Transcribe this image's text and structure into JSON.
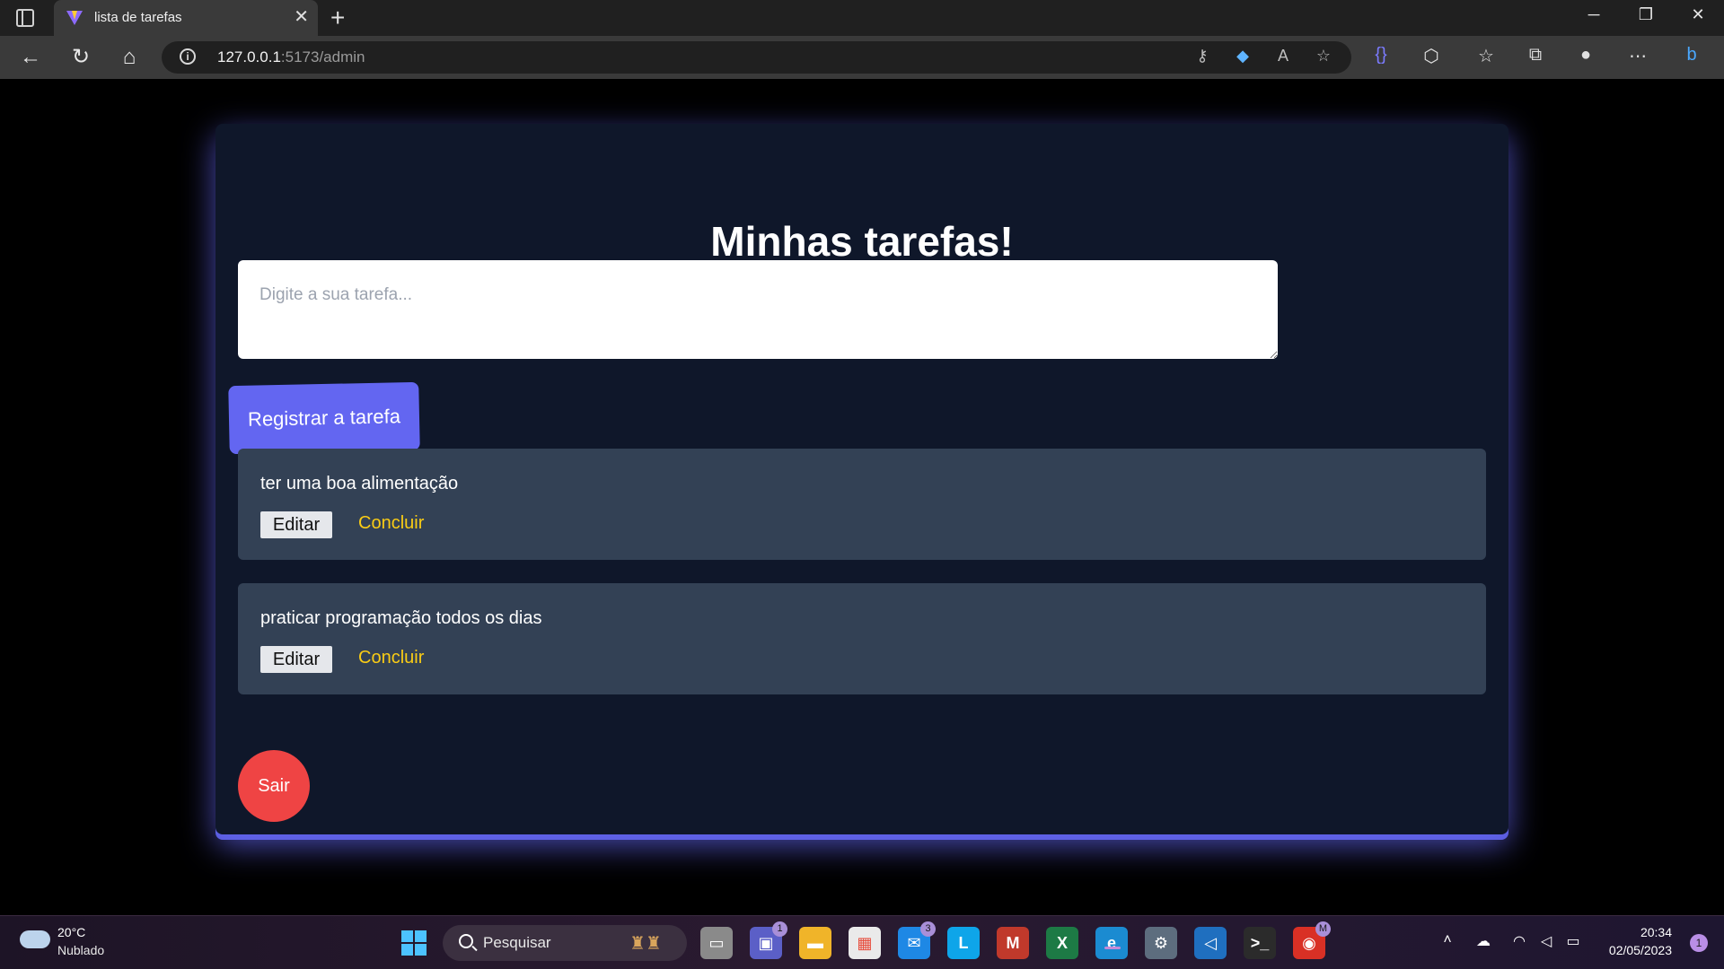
{
  "browser": {
    "tab_title": "lista de tarefas",
    "tab_close": "✕",
    "new_tab": "+",
    "url_host": "127.0.0.1",
    "url_rest": ":5173/admin",
    "window_controls": {
      "minimize": "─",
      "maximize": "❐",
      "close": "✕"
    }
  },
  "page": {
    "title": "Minhas tarefas!",
    "input_placeholder": "Digite a sua tarefa...",
    "register_button": "Registrar a tarefa",
    "tasks": [
      {
        "text": "ter uma boa alimentação",
        "edit_label": "Editar",
        "done_label": "Concluir"
      },
      {
        "text": "praticar programação todos os dias",
        "edit_label": "Editar",
        "done_label": "Concluir"
      }
    ],
    "exit_button": "Sair",
    "colors": {
      "accent": "#6366f1",
      "card": "#0f172a",
      "task": "#334155",
      "done": "#facc15",
      "exit": "#ef4444"
    }
  },
  "taskbar": {
    "weather_temp": "20°C",
    "weather_desc": "Nublado",
    "search_label": "Pesquisar",
    "teams_badge": "1",
    "mail_badge": "3",
    "chrome_badge": "M",
    "clock_time": "20:34",
    "clock_date": "02/05/2023",
    "notification_count": "1"
  }
}
